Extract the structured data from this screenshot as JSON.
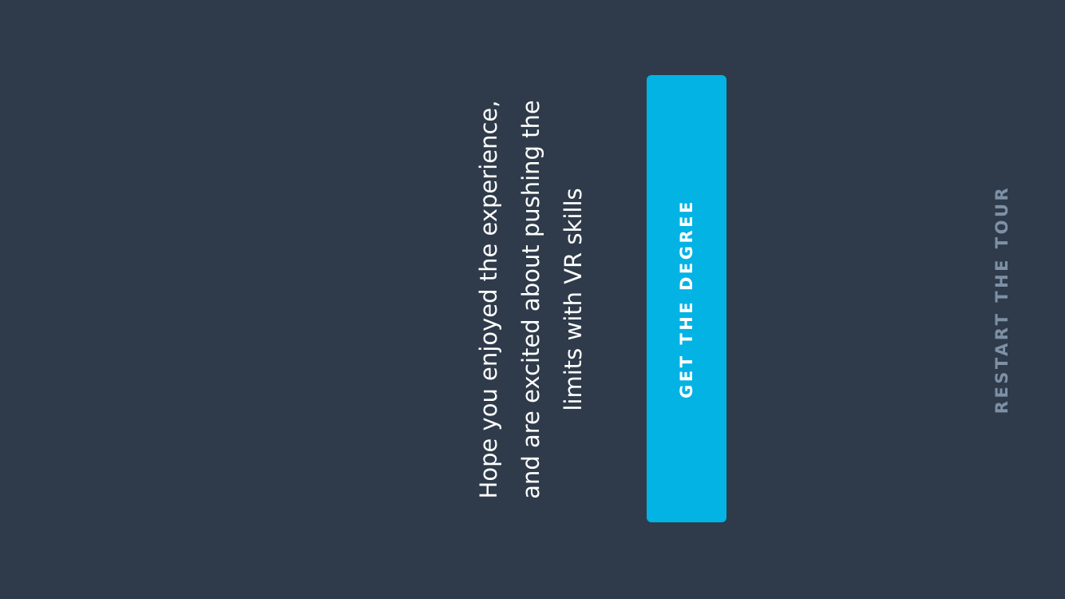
{
  "message": {
    "text": "Hope you enjoyed the experience, and are excited about pushing the limits with VR skills"
  },
  "cta": {
    "label": "GET THE DEGREE"
  },
  "restart": {
    "label": "RESTART THE TOUR"
  },
  "colors": {
    "background": "#2f3b4a",
    "accent": "#02b3e4",
    "muted": "#7d90a6",
    "text": "#ffffff"
  }
}
